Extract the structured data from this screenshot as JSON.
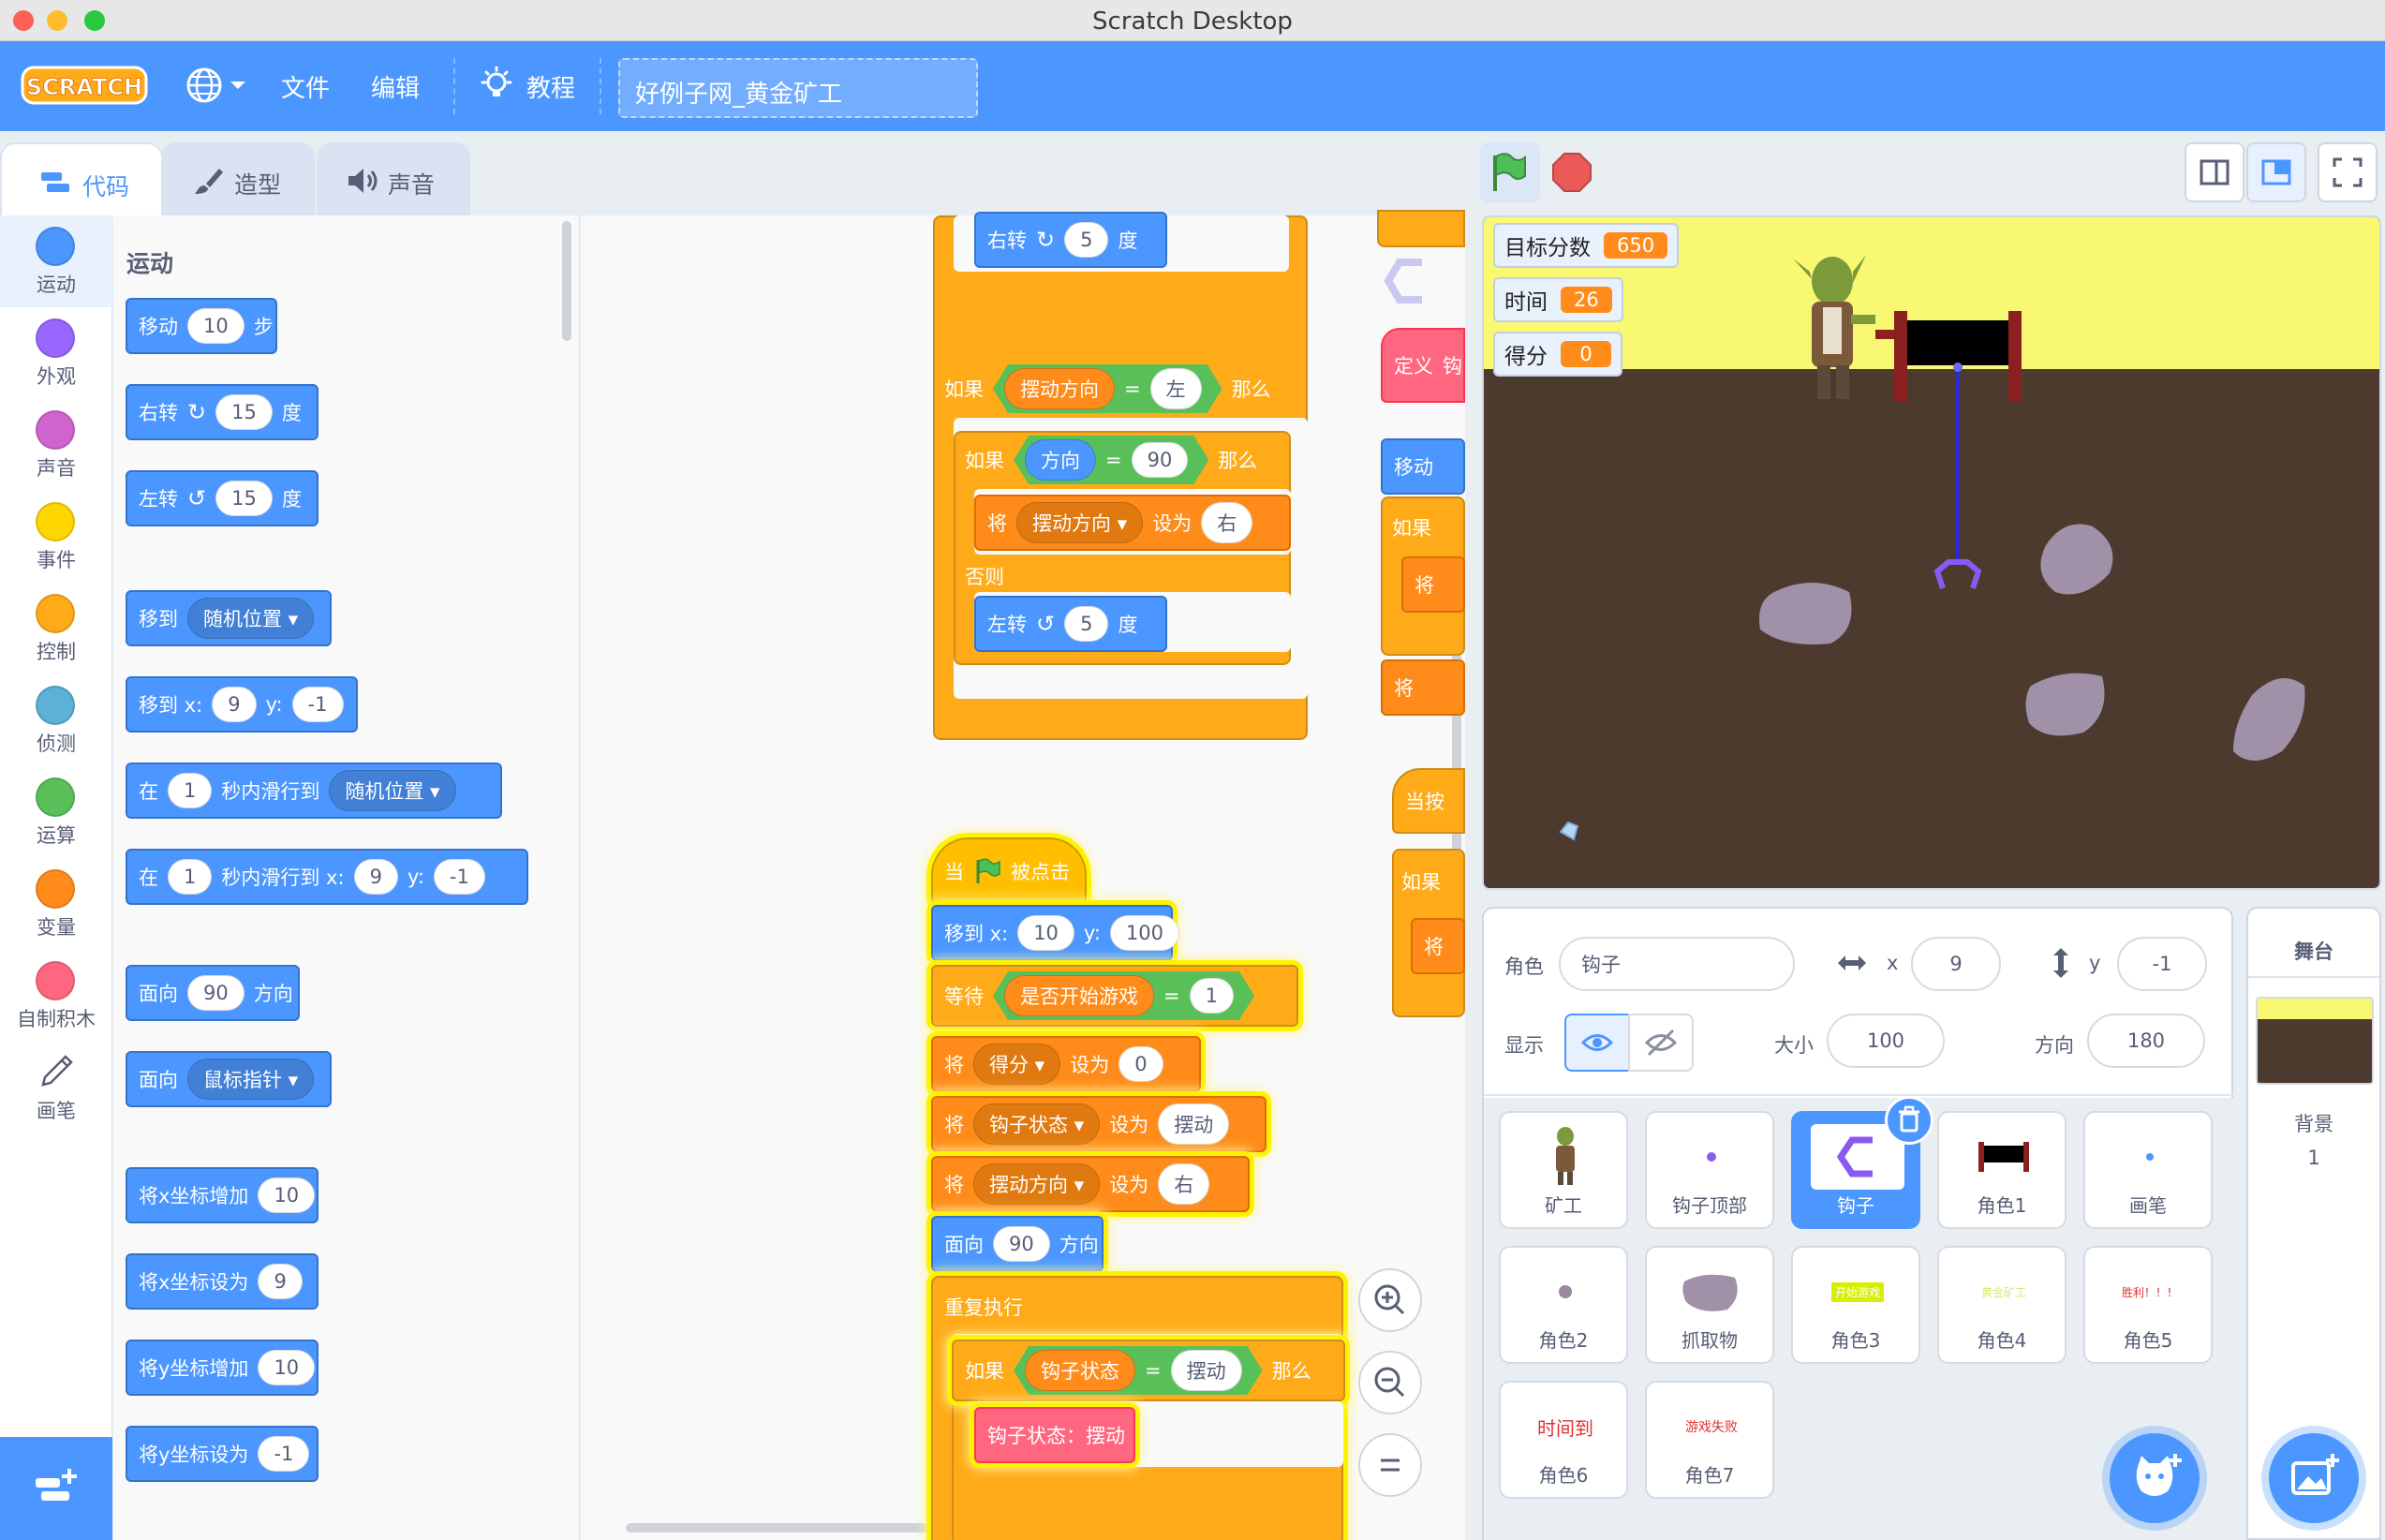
{
  "window": {
    "title": "Scratch Desktop"
  },
  "menu": {
    "logo": "SCRATCH",
    "file": "文件",
    "edit": "编辑",
    "tutorials": "教程",
    "project_title": "好例子网_黄金矿工"
  },
  "tabs": {
    "code": "代码",
    "costumes": "造型",
    "sounds": "声音"
  },
  "categories": [
    {
      "label": "运动",
      "color": "#4c97ff"
    },
    {
      "label": "外观",
      "color": "#9966ff"
    },
    {
      "label": "声音",
      "color": "#cf63cf"
    },
    {
      "label": "事件",
      "color": "#ffd500"
    },
    {
      "label": "控制",
      "color": "#ffab19"
    },
    {
      "label": "侦测",
      "color": "#5cb1d6"
    },
    {
      "label": "运算",
      "color": "#59c059"
    },
    {
      "label": "变量",
      "color": "#ff8c1a"
    },
    {
      "label": "自制积木",
      "color": "#ff6680"
    },
    {
      "label": "画笔",
      "color": "#0fbd8c"
    }
  ],
  "palette": {
    "heading": "运动",
    "move": {
      "a": "移动",
      "n": "10",
      "b": "步"
    },
    "turn_right": {
      "a": "右转",
      "n": "15",
      "b": "度"
    },
    "turn_left": {
      "a": "左转",
      "n": "15",
      "b": "度"
    },
    "goto": {
      "a": "移到",
      "opt": "随机位置"
    },
    "goto_xy": {
      "a": "移到 x:",
      "x": "9",
      "y_label": "y:",
      "y": "-1"
    },
    "glide": {
      "a": "在",
      "n": "1",
      "b": "秒内滑行到",
      "opt": "随机位置"
    },
    "glide_xy": {
      "a": "在",
      "n": "1",
      "b": "秒内滑行到 x:",
      "x": "9",
      "y_label": "y:",
      "y": "-1"
    },
    "point_dir": {
      "a": "面向",
      "n": "90",
      "b": "方向"
    },
    "point_towards": {
      "a": "面向",
      "opt": "鼠标指针"
    },
    "change_x": {
      "a": "将x坐标增加",
      "n": "10"
    },
    "set_x": {
      "a": "将x坐标设为",
      "n": "9"
    },
    "change_y": {
      "a": "将y坐标增加",
      "n": "10"
    },
    "set_y": {
      "a": "将y坐标设为",
      "n": "-1"
    }
  },
  "script1": {
    "turn_right": {
      "a": "右转",
      "n": "5",
      "b": "度"
    },
    "if1": {
      "a": "如果",
      "var": "摆动方向",
      "eq": "=",
      "val": "左",
      "b": "那么"
    },
    "if2": {
      "a": "如果",
      "var": "方向",
      "eq": "=",
      "val": "90",
      "b": "那么"
    },
    "set": {
      "a": "将",
      "var": "摆动方向",
      "b": "设为",
      "val": "右"
    },
    "else": "否则",
    "turn_left": {
      "a": "左转",
      "n": "5",
      "b": "度"
    }
  },
  "script2": {
    "hat": {
      "a": "当",
      "b": "被点击"
    },
    "goto": {
      "a": "移到 x:",
      "x": "10",
      "y_label": "y:",
      "y": "100"
    },
    "wait": {
      "a": "等待",
      "var": "是否开始游戏",
      "eq": "=",
      "val": "1"
    },
    "set_score": {
      "a": "将",
      "var": "得分",
      "b": "设为",
      "val": "0"
    },
    "set_hook": {
      "a": "将",
      "var": "钩子状态",
      "b": "设为",
      "val": "摆动"
    },
    "set_dir": {
      "a": "将",
      "var": "摆动方向",
      "b": "设为",
      "val": "右"
    },
    "point": {
      "a": "面向",
      "n": "90",
      "b": "方向"
    },
    "forever": "重复执行",
    "if": {
      "a": "如果",
      "var": "钩子状态",
      "eq": "=",
      "val": "摆动",
      "b": "那么"
    },
    "call": "钩子状态：摆动"
  },
  "script3": {
    "define": "定义",
    "define_tail": "钩",
    "move": "移动",
    "if": "如果",
    "set": "将",
    "set2": "将",
    "when": "当按",
    "if2": "如果",
    "set3": "将"
  },
  "stage": {
    "monitors": [
      {
        "label": "目标分数",
        "value": "650"
      },
      {
        "label": "时间",
        "value": "26"
      },
      {
        "label": "得分",
        "value": "0"
      }
    ]
  },
  "sprite_info": {
    "sprite_label": "角色",
    "sprite_name": "钩子",
    "x_label": "x",
    "x": "9",
    "y_label": "y",
    "y": "-1",
    "show_label": "显示",
    "size_label": "大小",
    "size": "100",
    "direction_label": "方向",
    "direction": "180"
  },
  "sprites": [
    {
      "name": "矿工"
    },
    {
      "name": "钩子顶部"
    },
    {
      "name": "钩子",
      "selected": true
    },
    {
      "name": "角色1"
    },
    {
      "name": "画笔"
    },
    {
      "name": "角色2"
    },
    {
      "name": "抓取物"
    },
    {
      "name": "角色3",
      "thumb_text": "开始游戏"
    },
    {
      "name": "角色4",
      "thumb_text": "黄金矿工"
    },
    {
      "name": "角色5",
      "thumb_text": "胜利！！！"
    },
    {
      "name": "角色6",
      "thumb_text": "时间到"
    },
    {
      "name": "角色7",
      "thumb_text": "游戏失败"
    }
  ],
  "stage_pane": {
    "title": "舞台",
    "backdrop_label": "背景",
    "backdrop_count": "1"
  }
}
